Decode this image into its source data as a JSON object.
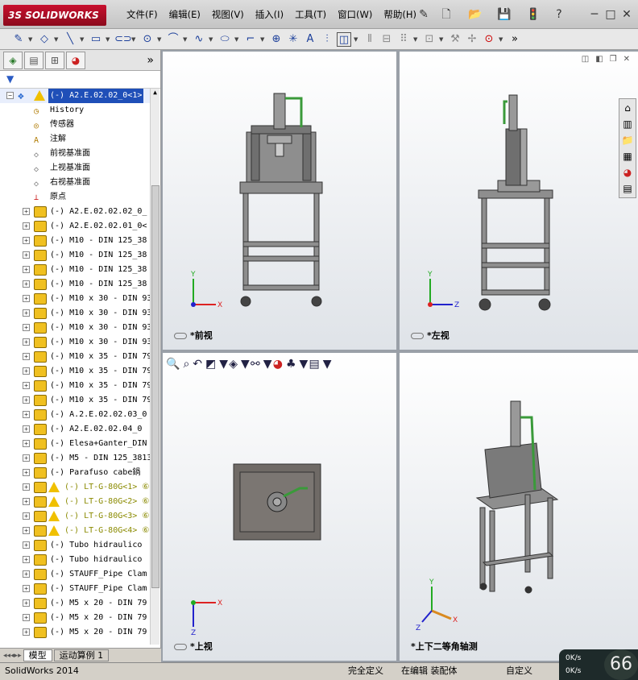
{
  "app": {
    "logo": "SOLIDWORKS",
    "ds": "3S"
  },
  "menu": [
    "文件(F)",
    "编辑(E)",
    "视图(V)",
    "插入(I)",
    "工具(T)",
    "窗口(W)",
    "帮助(H)"
  ],
  "window_controls": [
    "?",
    "─",
    "□",
    "✕"
  ],
  "feature_tree": {
    "root": "(-) A2.E.02.02_0<1>",
    "items": [
      {
        "label": "History",
        "kind": "history"
      },
      {
        "label": "传感器",
        "kind": "sensor"
      },
      {
        "label": "注解",
        "kind": "annotation"
      },
      {
        "label": "前视基准面",
        "kind": "plane"
      },
      {
        "label": "上视基准面",
        "kind": "plane"
      },
      {
        "label": "右视基准面",
        "kind": "plane"
      },
      {
        "label": "原点",
        "kind": "origin"
      },
      {
        "label": "(-) A2.E.02.02.02_0_",
        "kind": "part"
      },
      {
        "label": "(-) A2.E.02.02.01_0<",
        "kind": "part"
      },
      {
        "label": "(-) M10 - DIN 125_38",
        "kind": "part"
      },
      {
        "label": "(-) M10 - DIN 125_38",
        "kind": "part"
      },
      {
        "label": "(-) M10 - DIN 125_38",
        "kind": "part"
      },
      {
        "label": "(-) M10 - DIN 125_38",
        "kind": "part"
      },
      {
        "label": "(-) M10 x 30 - DIN 93",
        "kind": "part"
      },
      {
        "label": "(-) M10 x 30 - DIN 93",
        "kind": "part"
      },
      {
        "label": "(-) M10 x 30 - DIN 93",
        "kind": "part"
      },
      {
        "label": "(-) M10 x 30 - DIN 93",
        "kind": "part"
      },
      {
        "label": "(-) M10 x 35 - DIN 79",
        "kind": "part"
      },
      {
        "label": "(-) M10 x 35 - DIN 79",
        "kind": "part"
      },
      {
        "label": "(-) M10 x 35 - DIN 79",
        "kind": "part"
      },
      {
        "label": "(-) M10 x 35 - DIN 79",
        "kind": "part"
      },
      {
        "label": "(-) A.2.E.02.02.03_0",
        "kind": "part"
      },
      {
        "label": "(-) A2.E.02.02.04_0",
        "kind": "part"
      },
      {
        "label": "(-) Elesa+Ganter_DIN",
        "kind": "part"
      },
      {
        "label": "(-) M5 - DIN 125_3813",
        "kind": "part"
      },
      {
        "label": "(-) Parafuso cabe鍋",
        "kind": "part"
      },
      {
        "label": "(-) LT-G-80G<1> ⑥",
        "kind": "warn"
      },
      {
        "label": "(-) LT-G-80G<2> ⑥",
        "kind": "warn"
      },
      {
        "label": "(-) LT-G-80G<3> ⑥",
        "kind": "warn"
      },
      {
        "label": "(-) LT-G-80G<4> ⑥",
        "kind": "warn"
      },
      {
        "label": "(-) Tubo hidraulico",
        "kind": "part"
      },
      {
        "label": "(-) Tubo hidraulico",
        "kind": "part"
      },
      {
        "label": "(-) STAUFF_Pipe Clam",
        "kind": "part"
      },
      {
        "label": "(-) STAUFF_Pipe Clam",
        "kind": "part"
      },
      {
        "label": "(-) M5 x 20 - DIN 79",
        "kind": "part"
      },
      {
        "label": "(-) M5 x 20 - DIN 79",
        "kind": "part"
      },
      {
        "label": "(-) M5 x 20 - DIN 79",
        "kind": "part"
      }
    ]
  },
  "bottom_tabs": [
    "模型",
    "运动算例 1"
  ],
  "viewports": [
    {
      "label": "*前视"
    },
    {
      "label": "*左视"
    },
    {
      "label": "*上视"
    },
    {
      "label": "*上下二等角轴测"
    }
  ],
  "status": {
    "app_version": "SolidWorks 2014",
    "state": "完全定义",
    "mode": "在编辑 装配体",
    "custom": "自定义",
    "net_up": "0K/s",
    "net_down": "0K/s",
    "net_num": "66"
  }
}
